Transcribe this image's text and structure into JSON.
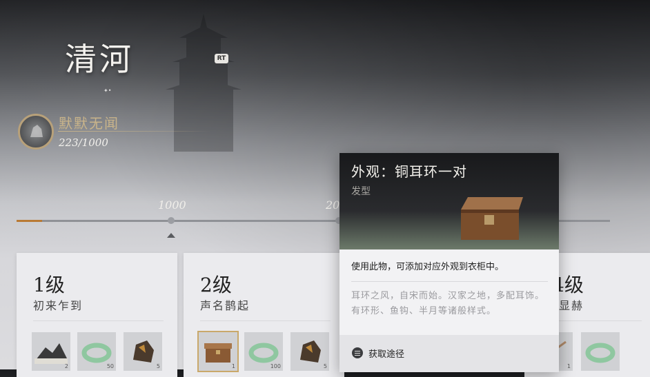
{
  "area": {
    "title": "清河",
    "key_hint": "RT"
  },
  "rank": {
    "name": "默默无闻",
    "progress": "223/1000",
    "fill_fraction": 0.223
  },
  "milestones": {
    "first": "1000",
    "second": "20"
  },
  "levels": [
    {
      "level": "1级",
      "name": "初来乍到",
      "rewards": [
        {
          "icon": "map-scroll-icon",
          "count": "2"
        },
        {
          "icon": "jade-bracelet-icon",
          "count": "50"
        },
        {
          "icon": "ore-stone-icon",
          "count": "5"
        }
      ]
    },
    {
      "level": "2级",
      "name": "声名鹊起",
      "rewards": [
        {
          "icon": "wooden-chest-icon",
          "count": "1"
        },
        {
          "icon": "jade-bracelet-icon",
          "count": "100"
        },
        {
          "icon": "ore-stone-icon",
          "count": "5"
        }
      ]
    },
    {
      "level": "4级",
      "name": "显赫",
      "rewards": [
        {
          "icon": "item-icon",
          "count": "1"
        },
        {
          "icon": "jade-bracelet-icon",
          "count": ""
        }
      ]
    }
  ],
  "tooltip": {
    "title": "外观：铜耳环一对",
    "category": "发型",
    "use": "使用此物，可添加对应外观到衣柜中。",
    "flavor": "耳环之风，自宋而始。汉家之地，多配耳饰。有环形、鱼钩、半月等诸般样式。",
    "source_label": "获取途径",
    "item_icon": "wooden-chest-icon"
  },
  "colors": {
    "accent_gold": "#c9b48a",
    "progress_fill": "#b97a34"
  }
}
